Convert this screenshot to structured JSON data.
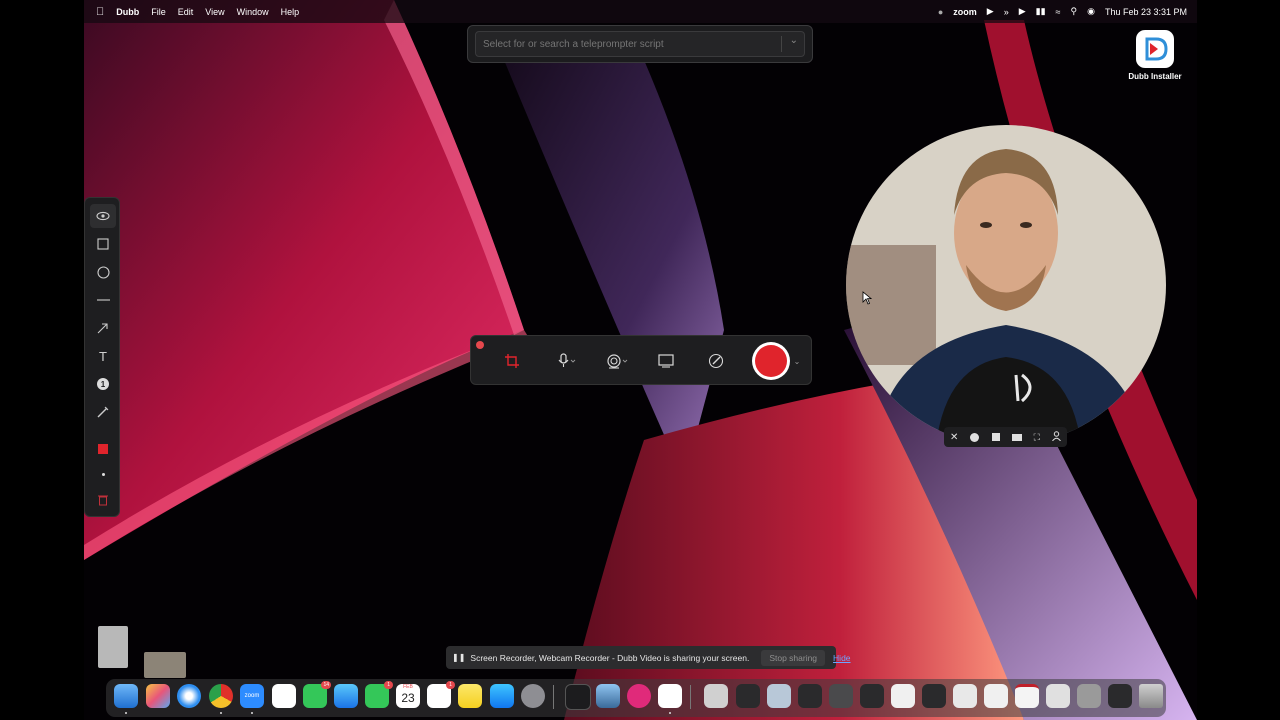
{
  "menubar": {
    "apple_icon": "apple-icon",
    "app_name": "Dubb",
    "menus": [
      "File",
      "Edit",
      "View",
      "Window",
      "Help"
    ],
    "zoom_label": "zoom",
    "datetime": "Thu Feb 23  3:31 PM"
  },
  "teleprompter": {
    "placeholder": "Select for or search a teleprompter script"
  },
  "desktop": {
    "installer_label": "Dubb Installer"
  },
  "annotation_tools": [
    {
      "name": "eye-icon"
    },
    {
      "name": "rectangle-icon"
    },
    {
      "name": "circle-icon"
    },
    {
      "name": "line-icon"
    },
    {
      "name": "arrow-icon"
    },
    {
      "name": "text-icon",
      "glyph": "T"
    },
    {
      "name": "number-stamp-icon",
      "glyph": "1"
    },
    {
      "name": "pencil-icon"
    },
    {
      "name": "color-swatch",
      "color": "#e0242c"
    },
    {
      "name": "stroke-size-dot"
    },
    {
      "name": "trash-icon"
    }
  ],
  "recorder": {
    "tools": [
      "crop-icon",
      "microphone-icon",
      "webcam-icon",
      "screen-icon",
      "annotate-icon"
    ],
    "record_color": "#e0242c"
  },
  "webcam_controls": [
    "close-icon",
    "circle-shape-icon",
    "square-shape-icon",
    "rectangle-shape-icon",
    "fullscreen-icon",
    "person-icon"
  ],
  "sharing_bar": {
    "message": "Screen Recorder, Webcam Recorder - Dubb Video is sharing your screen.",
    "stop_label": "Stop sharing",
    "hide_label": "Hide"
  },
  "dock": {
    "calendar_month": "FEB",
    "calendar_day": "23",
    "zoom_label": "zoom",
    "badges": {
      "slack": "14",
      "reminders": "1",
      "calendar": "1"
    }
  },
  "colors": {
    "accent_red": "#e0242c",
    "link_blue": "#6ea4ff"
  }
}
